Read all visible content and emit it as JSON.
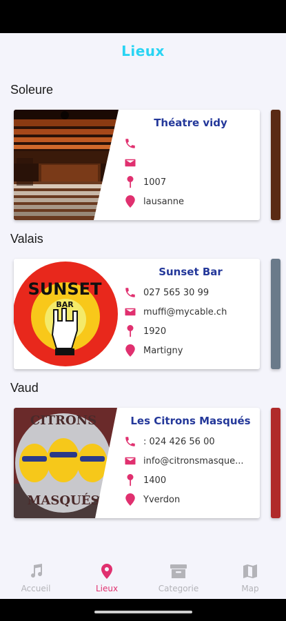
{
  "header": {
    "title": "Lieux"
  },
  "sections": [
    {
      "title": "Soleure",
      "card": {
        "name": "Théatre vidy",
        "phone": "",
        "email": "",
        "postcode": "1007",
        "city": "lausanne"
      }
    },
    {
      "title": "Valais",
      "card": {
        "name": "Sunset Bar",
        "phone": "027 565 30 99",
        "email": "muffi@mycable.ch",
        "postcode": "1920",
        "city": "Martigny"
      }
    },
    {
      "title": "Vaud",
      "card": {
        "name": "Les Citrons Masqués",
        "phone": ": 024 426 56 00",
        "email": "info@citronsmasque...",
        "postcode": "1400",
        "city": "Yverdon"
      }
    }
  ],
  "logos": {
    "sunset": {
      "line1": "SUNSET",
      "line2": "BAR"
    },
    "citrons": {
      "top": "CITRONS",
      "bottom": "MASQUÉS"
    }
  },
  "nav": [
    {
      "label": "Accueil",
      "icon": "music-note-icon",
      "active": false
    },
    {
      "label": "Lieux",
      "icon": "map-pin-icon",
      "active": true
    },
    {
      "label": "Categorie",
      "icon": "archive-box-icon",
      "active": false
    },
    {
      "label": "Map",
      "icon": "folded-map-icon",
      "active": false
    }
  ],
  "colors": {
    "accent": "#e0306f",
    "title": "#29d4f3",
    "card_name": "#24389a",
    "inactive": "#b3b3b8"
  }
}
